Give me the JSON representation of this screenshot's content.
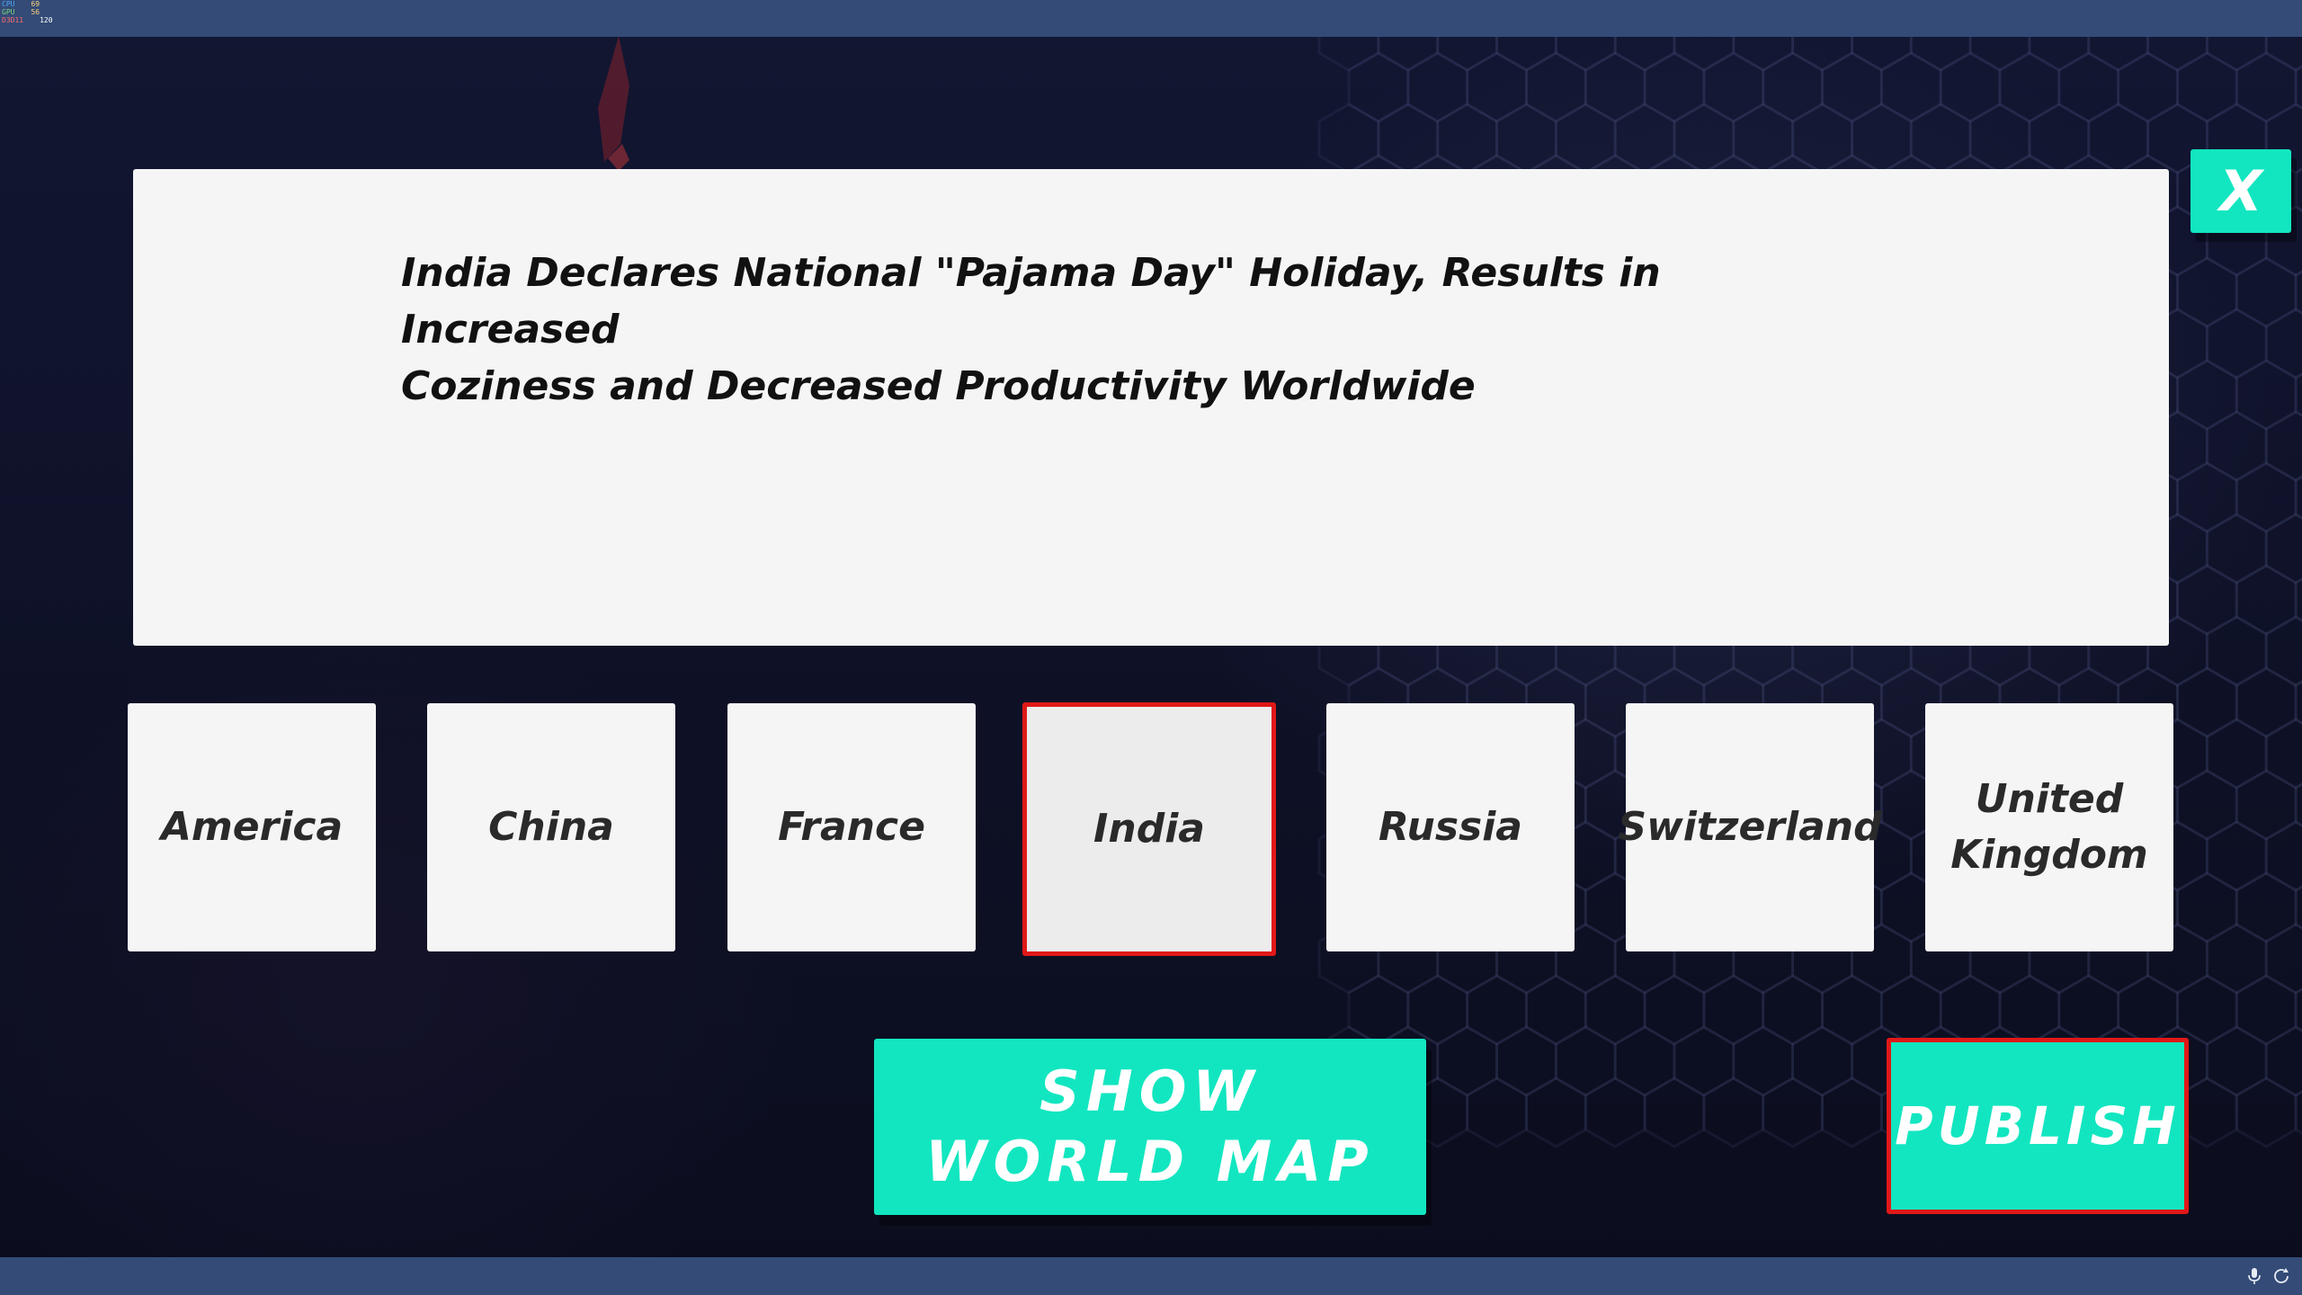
{
  "overlay": {
    "cpu_label": "CPU",
    "cpu_value": "69",
    "gpu_label": "GPU",
    "gpu_value": "56",
    "fps_label": "D3D11",
    "fps_value": "120"
  },
  "headline": {
    "line1": "India Declares National \"Pajama Day\" Holiday, Results in Increased",
    "line2": "Coziness and Decreased Productivity Worldwide"
  },
  "close_button": {
    "label": "X",
    "icon": "close-icon"
  },
  "countries": [
    {
      "label": "America",
      "selected": false
    },
    {
      "label": "China",
      "selected": false
    },
    {
      "label": "France",
      "selected": false
    },
    {
      "label": "India",
      "selected": true
    },
    {
      "label": "Russia",
      "selected": false
    },
    {
      "label": "Switzerland",
      "selected": false
    },
    {
      "label": "United Kingdom",
      "selected": false
    }
  ],
  "actions": {
    "show_map_label": "SHOW WORLD MAP",
    "publish_label": "PUBLISH"
  },
  "taskbar": {
    "icons": [
      "microphone-icon",
      "sync-icon"
    ]
  },
  "colors": {
    "accent": "#12e6c0",
    "selection": "#e01818",
    "panel": "#f5f5f5",
    "bar": "#344b77"
  }
}
